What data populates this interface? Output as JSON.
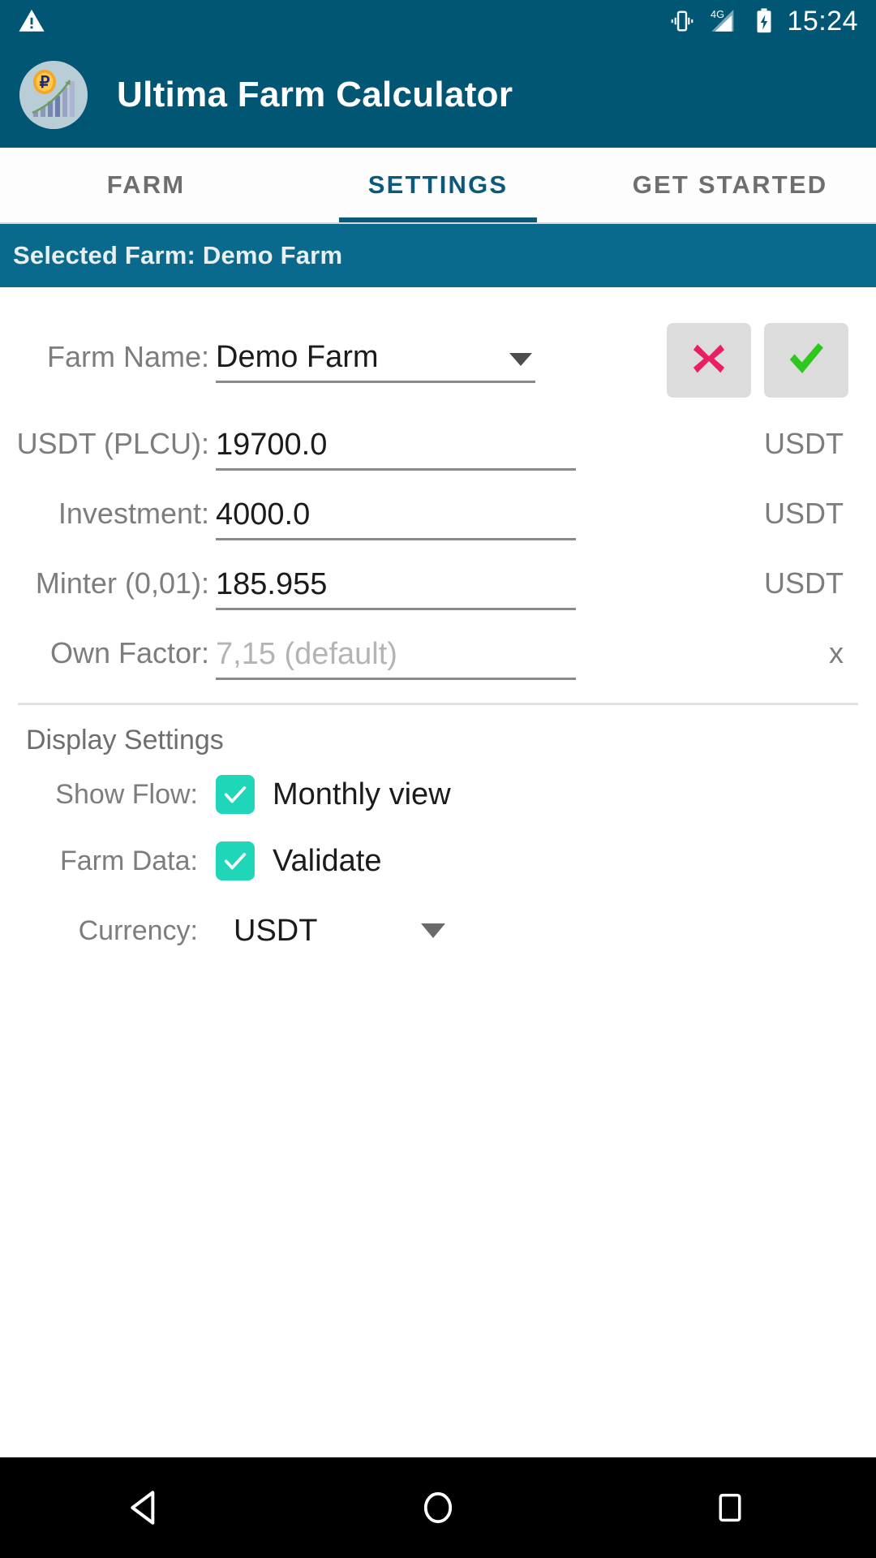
{
  "status_bar": {
    "warning_icon": "warning-triangle-icon",
    "vibrate_icon": "vibrate-icon",
    "network_label": "4G",
    "signal_icon": "signal-bars-icon",
    "battery_icon": "battery-charging-icon",
    "time": "15:24"
  },
  "app_bar": {
    "logo_icon": "app-logo-icon",
    "title": "Ultima Farm Calculator"
  },
  "tabs": [
    {
      "label": "FARM",
      "active": false
    },
    {
      "label": "SETTINGS",
      "active": true
    },
    {
      "label": "GET STARTED",
      "active": false
    }
  ],
  "selected_farm_bar": {
    "text": "Selected Farm: Demo Farm"
  },
  "form": {
    "farm_name": {
      "label": "Farm Name:",
      "value": "Demo Farm",
      "dropdown_icon": "chevron-down-icon",
      "cancel_icon": "cross-icon",
      "confirm_icon": "check-icon"
    },
    "fields": [
      {
        "label": "USDT (PLCU):",
        "value": "19700.0",
        "placeholder": "",
        "unit": "USDT",
        "is_placeholder": false
      },
      {
        "label": "Investment:",
        "value": "4000.0",
        "placeholder": "",
        "unit": "USDT",
        "is_placeholder": false
      },
      {
        "label": "Minter (0,01):",
        "value": "185.955",
        "placeholder": "",
        "unit": "USDT",
        "is_placeholder": false
      },
      {
        "label": "Own Factor:",
        "value": "",
        "placeholder": "7,15 (default)",
        "unit": "x",
        "is_placeholder": true
      }
    ]
  },
  "display_settings": {
    "title": "Display Settings",
    "show_flow": {
      "label": "Show Flow:",
      "option": "Monthly view",
      "checked": true
    },
    "farm_data": {
      "label": "Farm Data:",
      "option": "Validate",
      "checked": true
    },
    "currency": {
      "label": "Currency:",
      "value": "USDT",
      "dropdown_icon": "chevron-down-icon"
    }
  },
  "nav_bar": {
    "back": "back-triangle-icon",
    "home": "home-circle-icon",
    "recents": "recents-square-icon"
  },
  "colors": {
    "primary": "#015673",
    "farm_bar": "#0a6a8d",
    "accent_tab": "#0b5a79",
    "checkbox": "#1fd6b8",
    "cancel": "#e91e63",
    "confirm": "#2fc71f"
  }
}
